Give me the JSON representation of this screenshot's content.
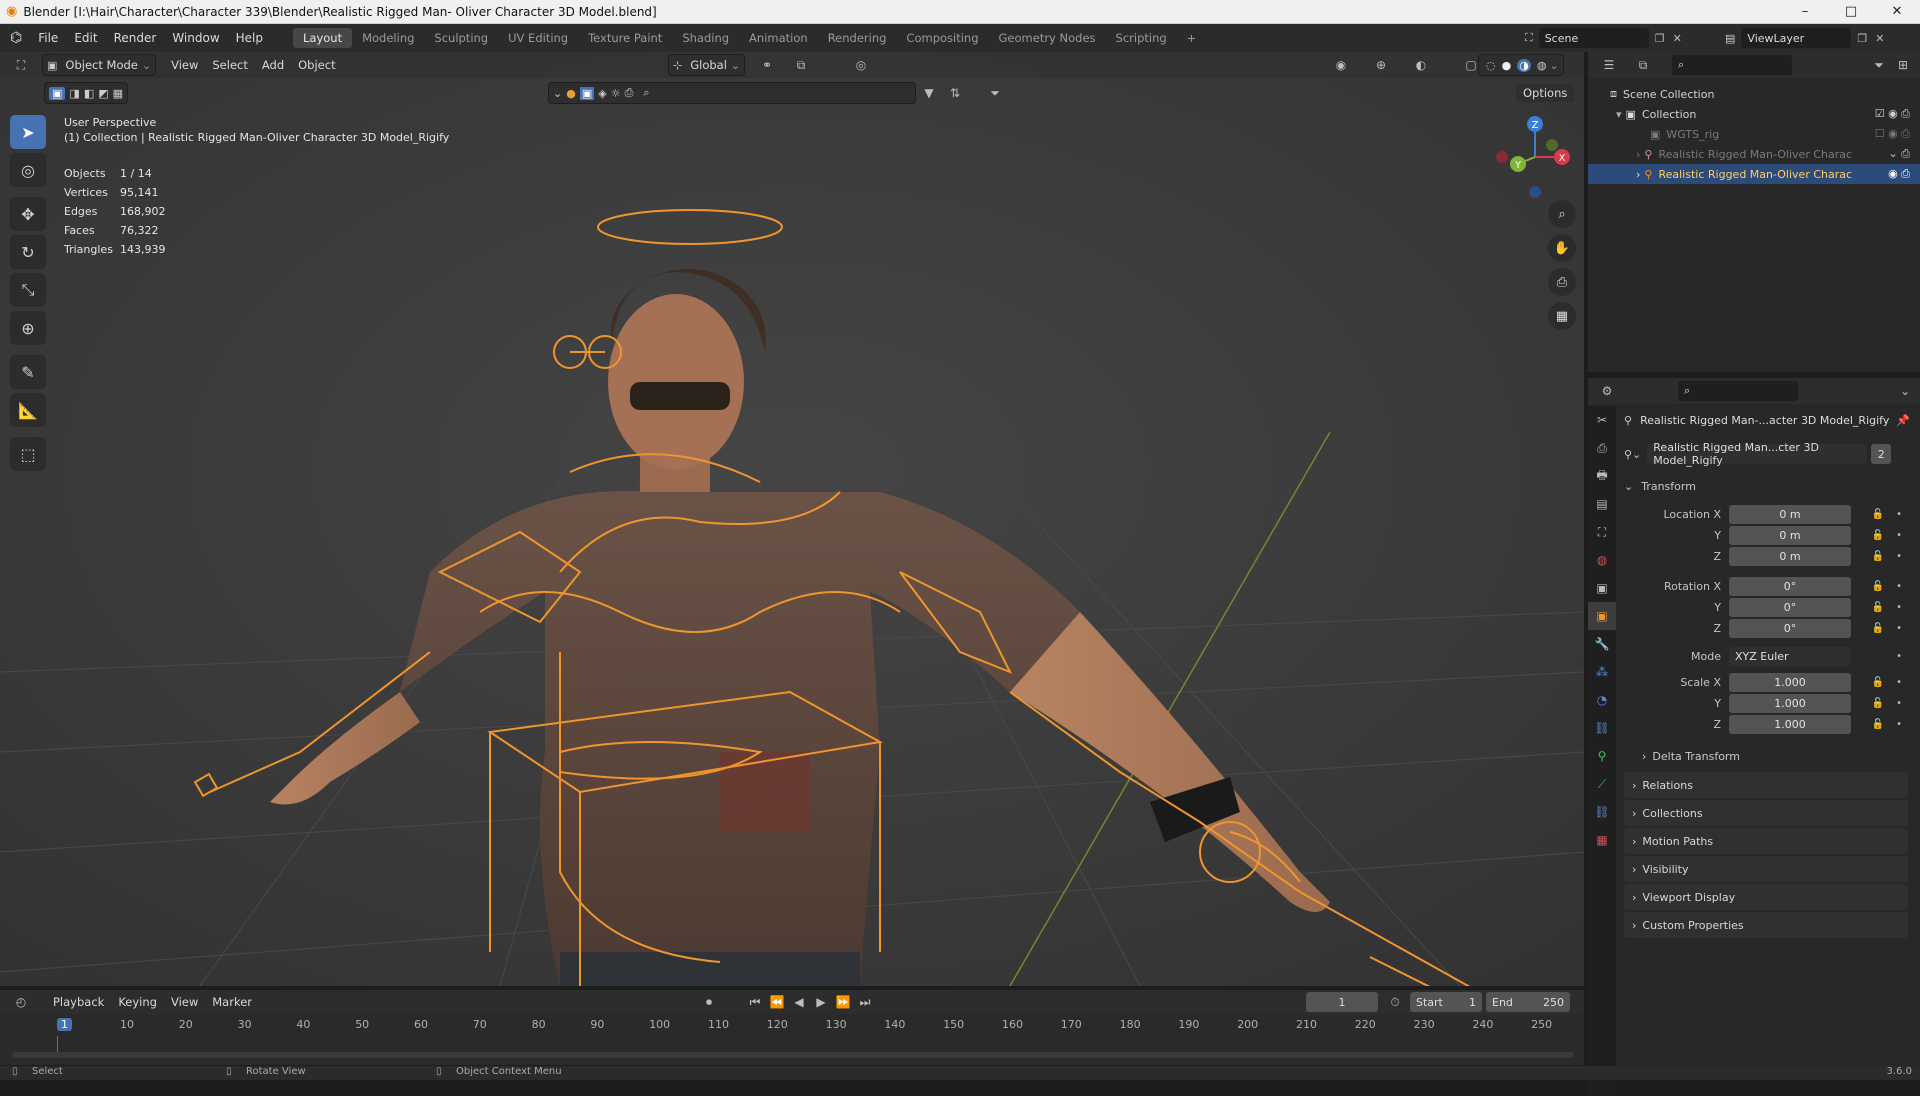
{
  "window": {
    "title": "Blender [I:\\Hair\\Character\\Character 339\\Blender\\Realistic Rigged Man- Oliver Character 3D Model.blend]",
    "minimize": "–",
    "maximize": "□",
    "close": "✕"
  },
  "menubar": {
    "items": [
      "File",
      "Edit",
      "Render",
      "Window",
      "Help"
    ]
  },
  "workspaces": [
    "Layout",
    "Modeling",
    "Sculpting",
    "UV Editing",
    "Texture Paint",
    "Shading",
    "Animation",
    "Rendering",
    "Compositing",
    "Geometry Nodes",
    "Scripting",
    "+"
  ],
  "scene": {
    "name": "Scene",
    "view_layer": "ViewLayer"
  },
  "viewport": {
    "mode": "Object Mode",
    "menus": [
      "View",
      "Select",
      "Add",
      "Object"
    ],
    "orientation": "Global",
    "options": "Options",
    "perspective": "User Perspective",
    "collection_line": "(1) Collection | Realistic Rigged Man-Oliver Character 3D Model_Rigify",
    "stats": [
      {
        "label": "Objects",
        "value": "1 / 14"
      },
      {
        "label": "Vertices",
        "value": "95,141"
      },
      {
        "label": "Edges",
        "value": "168,902"
      },
      {
        "label": "Faces",
        "value": "76,322"
      },
      {
        "label": "Triangles",
        "value": "143,939"
      }
    ],
    "gizmo": {
      "z": "Z",
      "y": "Y",
      "x": "X"
    }
  },
  "outliner": {
    "rows": [
      {
        "label": "Scene Collection"
      },
      {
        "label": "Collection"
      },
      {
        "label": "WGTS_rig"
      },
      {
        "label": "Realistic Rigged Man-Oliver Charac"
      },
      {
        "label": "Realistic Rigged Man-Oliver Charac"
      }
    ]
  },
  "properties": {
    "object_name": "Realistic Rigged Man-...acter 3D Model_Rigify",
    "data_name": "Realistic Rigged Man...cter 3D Model_Rigify",
    "data_users": "2",
    "transform_label": "Transform",
    "location": [
      {
        "label": "Location X",
        "value": "0 m"
      },
      {
        "label": "Y",
        "value": "0 m"
      },
      {
        "label": "Z",
        "value": "0 m"
      }
    ],
    "rotation": [
      {
        "label": "Rotation X",
        "value": "0°"
      },
      {
        "label": "Y",
        "value": "0°"
      },
      {
        "label": "Z",
        "value": "0°"
      }
    ],
    "mode_label": "Mode",
    "mode_value": "XYZ Euler",
    "scale": [
      {
        "label": "Scale X",
        "value": "1.000"
      },
      {
        "label": "Y",
        "value": "1.000"
      },
      {
        "label": "Z",
        "value": "1.000"
      }
    ],
    "delta": "Delta Transform",
    "panels": [
      "Relations",
      "Collections",
      "Motion Paths",
      "Visibility",
      "Viewport Display",
      "Custom Properties"
    ]
  },
  "timeline": {
    "menus": [
      "Playback",
      "Keying",
      "View",
      "Marker"
    ],
    "current_frame": "1",
    "start_label": "Start",
    "start": "1",
    "end_label": "End",
    "end": "250",
    "ticks": [
      "1",
      "10",
      "20",
      "30",
      "40",
      "50",
      "60",
      "70",
      "80",
      "90",
      "100",
      "110",
      "120",
      "130",
      "140",
      "150",
      "160",
      "170",
      "180",
      "190",
      "200",
      "210",
      "220",
      "230",
      "240",
      "250"
    ]
  },
  "statusbar": {
    "left": "Select",
    "middle": "Rotate View",
    "right": "Object Context Menu",
    "version": "3.6.0"
  },
  "colors": {
    "accent": "#4772b3",
    "rig": "#f0952e",
    "selected_row": "#2c4a7a"
  }
}
